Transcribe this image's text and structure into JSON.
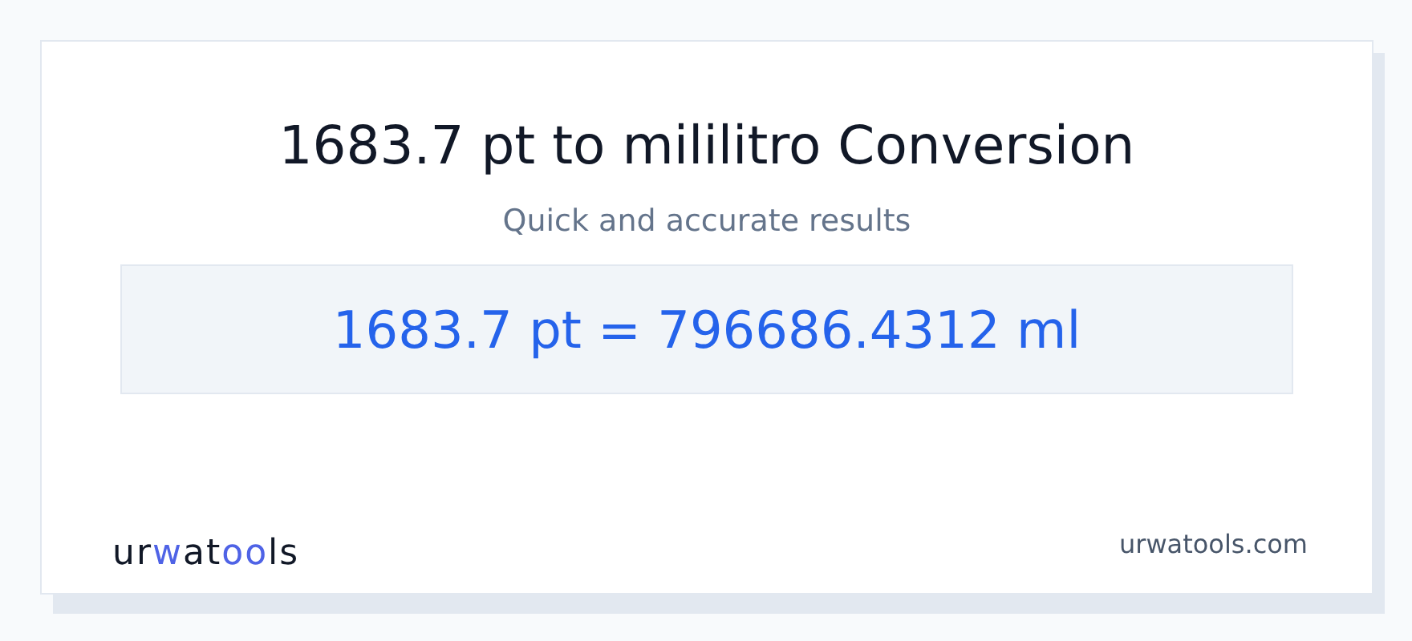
{
  "title": "1683.7 pt to mililitro Conversion",
  "subtitle": "Quick and accurate results",
  "result": "1683.7 pt = 796686.4312 ml",
  "logo": [
    {
      "text": "ur",
      "accent": false
    },
    {
      "text": "w",
      "accent": true
    },
    {
      "text": "at",
      "accent": false
    },
    {
      "text": "oo",
      "accent": true
    },
    {
      "text": "ls",
      "accent": false
    }
  ],
  "site": "urwatools.com"
}
